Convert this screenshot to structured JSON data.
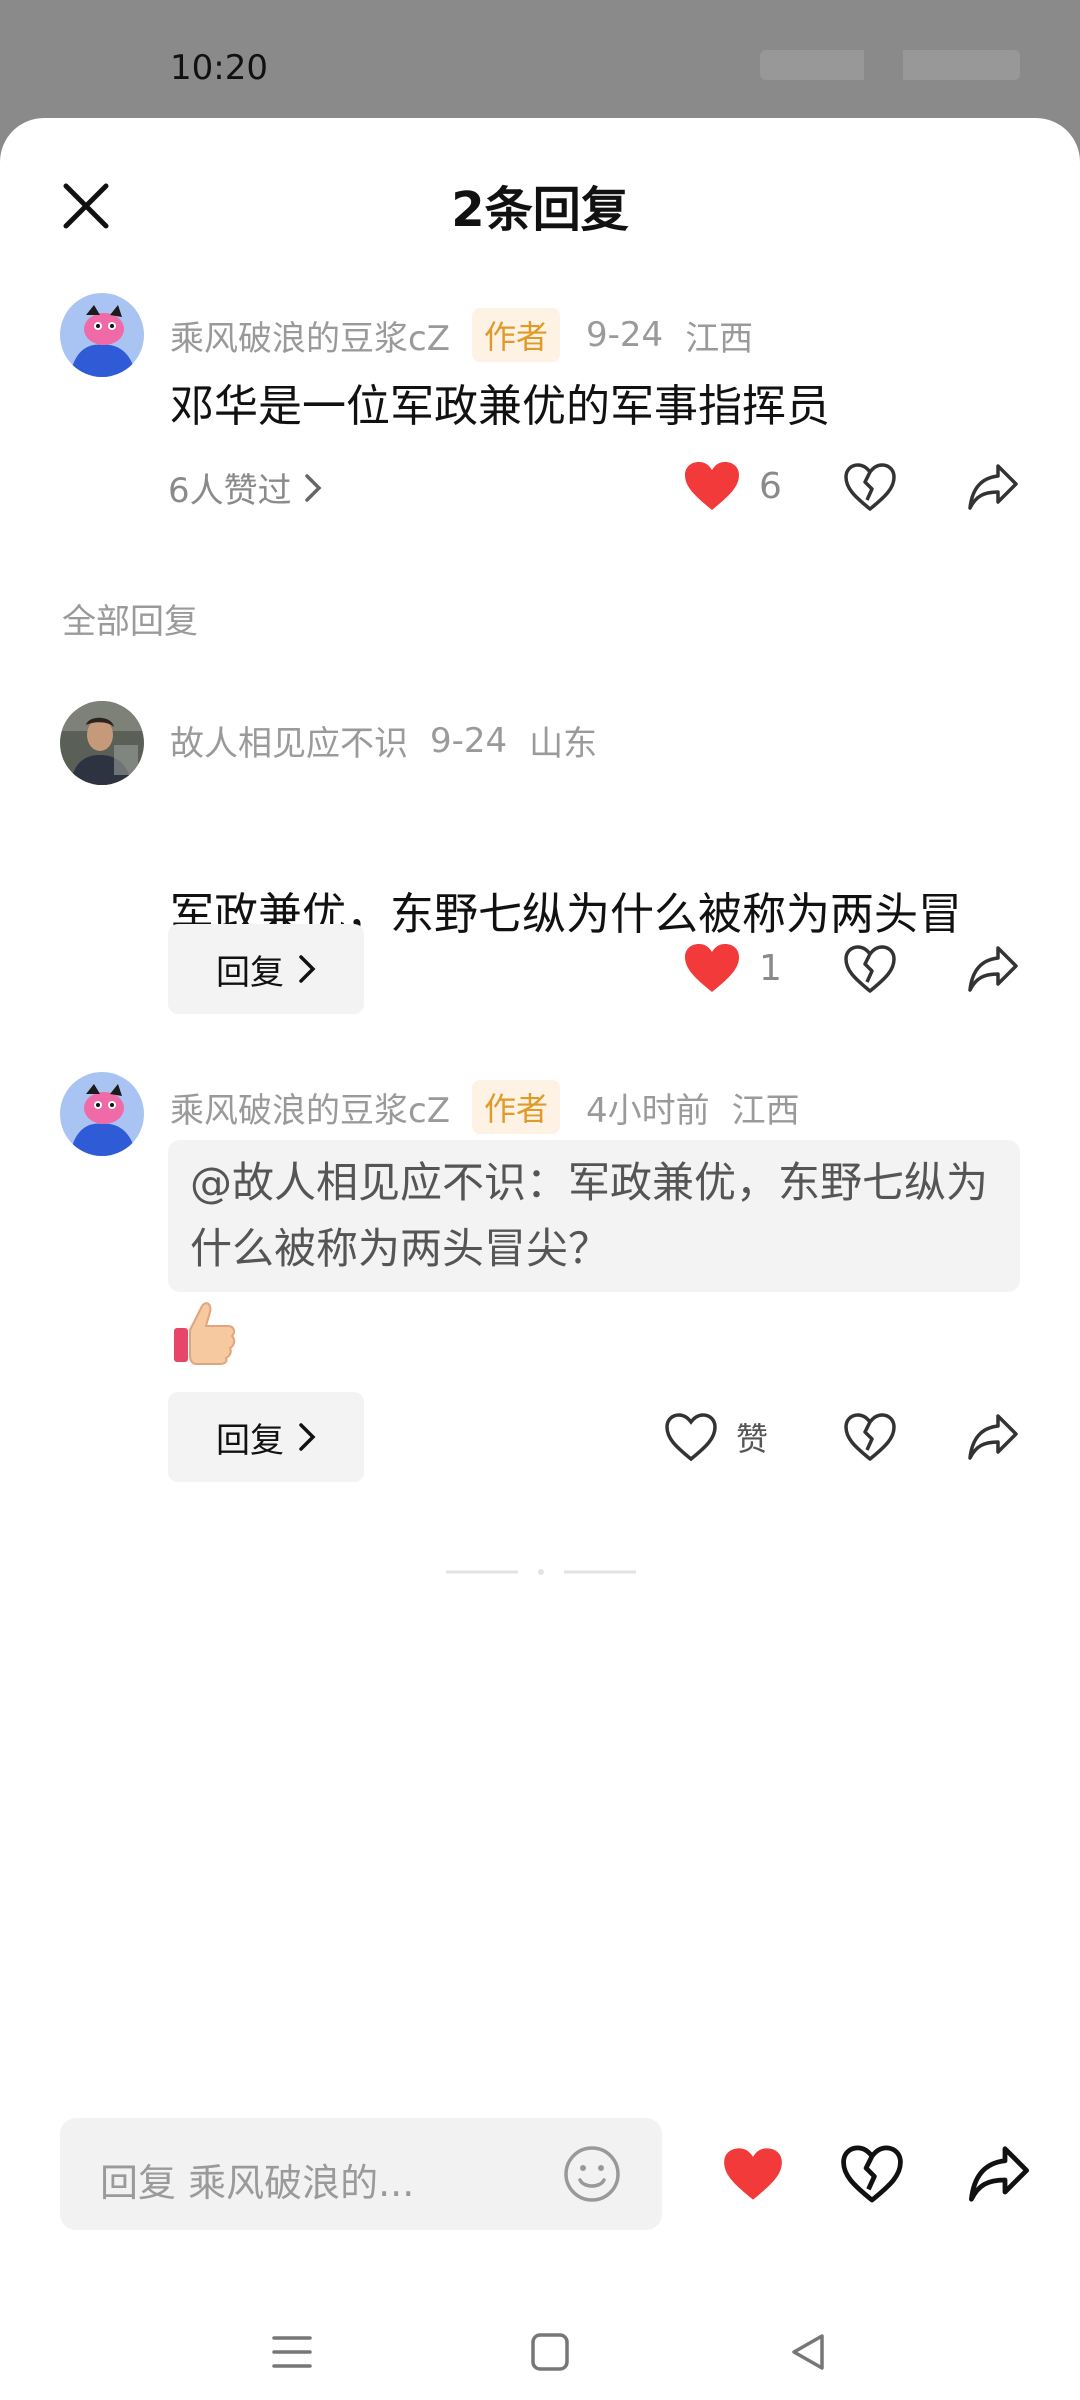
{
  "status_bar": {
    "time": "10:20"
  },
  "sheet": {
    "title": "2条回复"
  },
  "main_comment": {
    "author": "乘风破浪的豆浆cZ",
    "author_badge": "作者",
    "date": "9-24",
    "location": "江西",
    "text": "邓华是一位军政兼优的军事指挥员",
    "likers_label": "6人赞过",
    "like_count": "6"
  },
  "section_label": "全部回复",
  "replies": [
    {
      "author": "故人相见应不识",
      "date": "9-24",
      "location": "山东",
      "text": "军政兼优，东野七纵为什么被称为两头冒尖？",
      "reply_label": "回复",
      "like_count": "1"
    },
    {
      "author": "乘风破浪的豆浆cZ",
      "author_badge": "作者",
      "date": "4小时前",
      "location": "江西",
      "quote": "@故人相见应不识：军政兼优，东野七纵为什么被称为两头冒尖？",
      "emoji": "thumbs-up",
      "reply_label": "回复",
      "like_label": "赞"
    }
  ],
  "bottom_bar": {
    "input_placeholder": "回复 乘风破浪的..."
  },
  "colors": {
    "like_red": "#f23a3a",
    "badge_text": "#e09a2a",
    "badge_bg": "#fdf2e3"
  }
}
